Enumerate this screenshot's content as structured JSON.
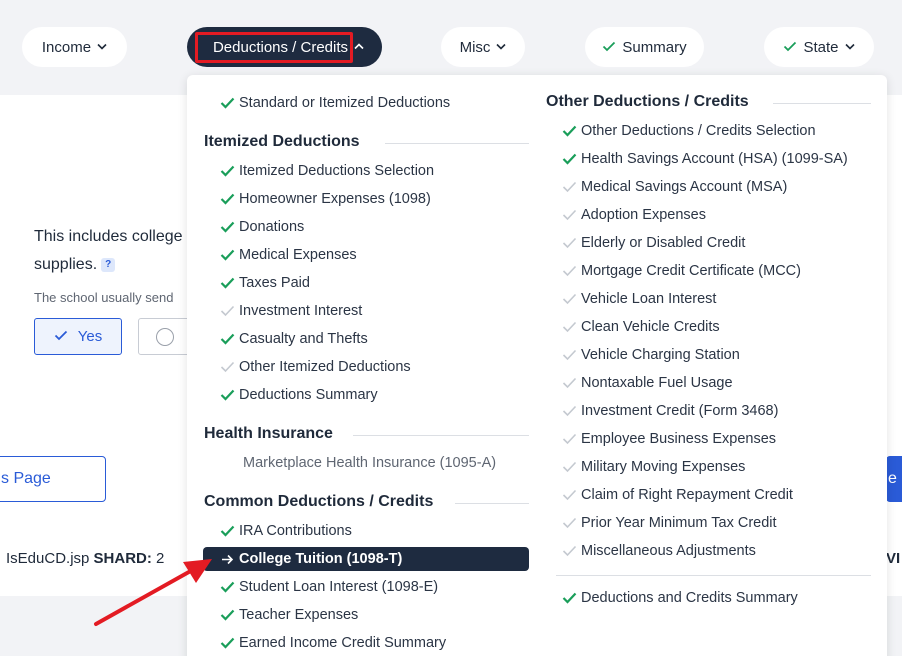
{
  "nav": {
    "income": "Income",
    "deductions": "Deductions / Credits",
    "misc": "Misc",
    "summary": "Summary",
    "state": "State"
  },
  "page": {
    "line1": "This includes college",
    "line2": "supplies.",
    "help": "?",
    "small": "The school usually send",
    "yes": "Yes",
    "prev": "s Page",
    "next": "e",
    "shard_prefix": "IsEduCD.jsp ",
    "shard_label": "SHARD:",
    "shard_value": " 2",
    "right_fragment": "VI"
  },
  "menu": {
    "left": {
      "top_item": "Standard or Itemized Deductions",
      "itemized": {
        "title": "Itemized Deductions",
        "items": [
          {
            "label": "Itemized Deductions Selection",
            "done": true
          },
          {
            "label": "Homeowner Expenses (1098)",
            "done": true
          },
          {
            "label": "Donations",
            "done": true
          },
          {
            "label": "Medical Expenses",
            "done": true
          },
          {
            "label": "Taxes Paid",
            "done": true
          },
          {
            "label": "Investment Interest",
            "done": false
          },
          {
            "label": "Casualty and Thefts",
            "done": true
          },
          {
            "label": "Other Itemized Deductions",
            "done": false
          },
          {
            "label": "Deductions Summary",
            "done": true
          }
        ]
      },
      "health": {
        "title": "Health Insurance",
        "items": [
          {
            "label": "Marketplace Health Insurance (1095-A)"
          }
        ]
      },
      "common": {
        "title": "Common Deductions / Credits",
        "items": [
          {
            "label": "IRA Contributions",
            "done": true
          },
          {
            "label": "College Tuition (1098-T)",
            "current": true
          },
          {
            "label": "Student Loan Interest (1098-E)",
            "done": true
          },
          {
            "label": "Teacher Expenses",
            "done": true
          },
          {
            "label": "Earned Income Credit Summary",
            "done": true
          }
        ]
      }
    },
    "right": {
      "title": "Other Deductions / Credits",
      "items": [
        {
          "label": "Other Deductions / Credits Selection",
          "done": true
        },
        {
          "label": "Health Savings Account (HSA) (1099-SA)",
          "done": true
        },
        {
          "label": "Medical Savings Account (MSA)",
          "done": false
        },
        {
          "label": "Adoption Expenses",
          "done": false
        },
        {
          "label": "Elderly or Disabled Credit",
          "done": false
        },
        {
          "label": "Mortgage Credit Certificate (MCC)",
          "done": false
        },
        {
          "label": "Vehicle Loan Interest",
          "done": false
        },
        {
          "label": "Clean Vehicle Credits",
          "done": false
        },
        {
          "label": "Vehicle Charging Station",
          "done": false
        },
        {
          "label": "Nontaxable Fuel Usage",
          "done": false
        },
        {
          "label": "Investment Credit (Form 3468)",
          "done": false
        },
        {
          "label": "Employee Business Expenses",
          "done": false
        },
        {
          "label": "Military Moving Expenses",
          "done": false
        },
        {
          "label": "Claim of Right Repayment Credit",
          "done": false
        },
        {
          "label": "Prior Year Minimum Tax Credit",
          "done": false
        },
        {
          "label": "Miscellaneous Adjustments",
          "done": false
        }
      ],
      "summary_item": "Deductions and Credits Summary"
    }
  },
  "colors": {
    "check_done": "#1a9e5a",
    "check_pending": "#c4c9d0",
    "annotation": "#e31b23",
    "nav_active": "#1e2b40"
  }
}
